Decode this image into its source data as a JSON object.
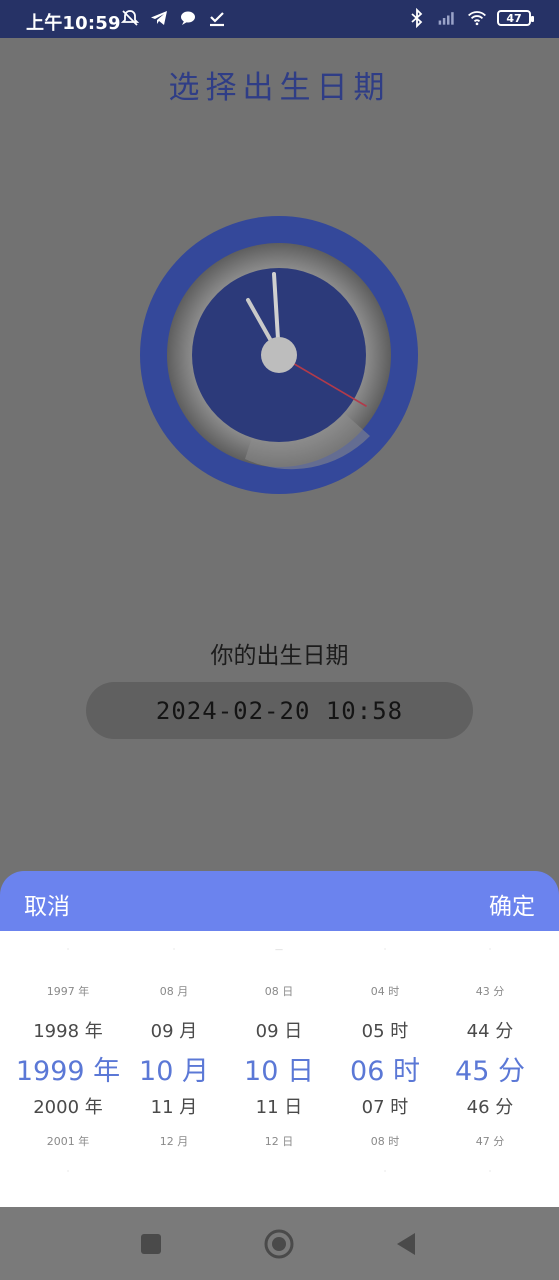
{
  "status_bar": {
    "time": "上午10:59",
    "left_icons": [
      "mute-bell-icon",
      "telegram-icon",
      "chat-bubble-icon",
      "download-done-icon"
    ],
    "right_icons": [
      "bluetooth-icon",
      "signal-icon",
      "wifi-icon"
    ],
    "battery": "47"
  },
  "title": "选择出生日期",
  "birth": {
    "label": "你的出生日期",
    "value": "2024-02-20 10:58"
  },
  "picker": {
    "cancel_label": "取消",
    "confirm_label": "确定",
    "columns": [
      {
        "items": [
          "·",
          "1997 年",
          "1998 年",
          "1999 年",
          "2000 年",
          "2001 年",
          "·"
        ]
      },
      {
        "items": [
          "·",
          "08 月",
          "09 月",
          "10 月",
          "11 月",
          "12 月",
          ""
        ]
      },
      {
        "items": [
          "—",
          "08 日",
          "09 日",
          "10 日",
          "11 日",
          "12 日",
          ""
        ]
      },
      {
        "items": [
          "·",
          "04 时",
          "05 时",
          "06 时",
          "07 时",
          "08 时",
          "·"
        ]
      },
      {
        "items": [
          "·",
          "43 分",
          "44 分",
          "45 分",
          "46 分",
          "47 分",
          "·"
        ]
      }
    ]
  },
  "colors": {
    "accent": "#6b83ee",
    "selected_text": "#5b78d6",
    "title": "#2f3d86",
    "clock_outer": "#34489a",
    "status_bar": "#263266"
  },
  "nav": {
    "icons": [
      "recent-apps-square-icon",
      "home-circle-icon",
      "back-triangle-icon"
    ]
  }
}
